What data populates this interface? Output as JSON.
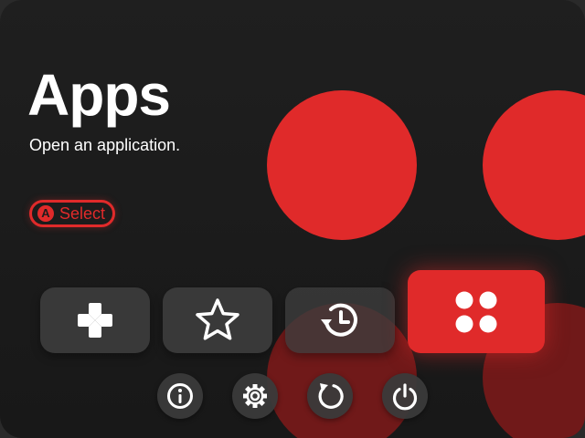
{
  "header": {
    "title": "Apps",
    "subtitle": "Open an application."
  },
  "hint": {
    "button_glyph": "A",
    "label": "Select"
  },
  "tiles": [
    {
      "id": "games",
      "icon": "gamepad-icon",
      "selected": false
    },
    {
      "id": "favorites",
      "icon": "star-icon",
      "selected": false
    },
    {
      "id": "history",
      "icon": "history-icon",
      "selected": false
    },
    {
      "id": "apps",
      "icon": "apps-grid-icon",
      "selected": true
    }
  ],
  "system_buttons": [
    {
      "id": "info",
      "icon": "info-icon"
    },
    {
      "id": "settings",
      "icon": "gear-icon"
    },
    {
      "id": "refresh",
      "icon": "refresh-icon"
    },
    {
      "id": "power",
      "icon": "power-icon"
    }
  ],
  "colors": {
    "accent": "#e02a2a",
    "background": "#1c1c1c",
    "tile": "#3c3c3c",
    "text": "#ffffff"
  }
}
